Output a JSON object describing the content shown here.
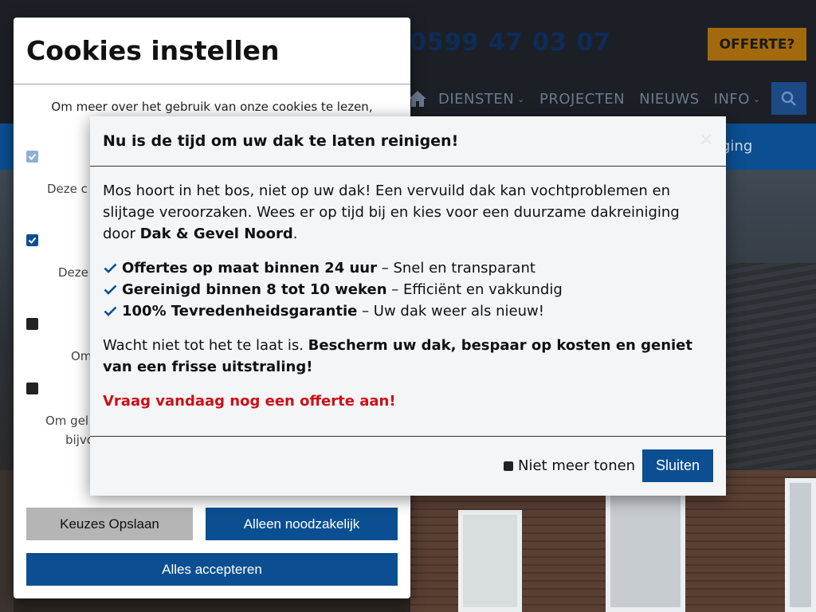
{
  "site": {
    "phone": "0599 47 03 07",
    "offer_button": "OFFERTE?",
    "nav": [
      {
        "label": "DIENSTEN",
        "has_dropdown": true
      },
      {
        "label": "PROJECTEN",
        "has_dropdown": false
      },
      {
        "label": "NIEUWS",
        "has_dropdown": false
      },
      {
        "label": "INFO",
        "has_dropdown": true
      }
    ],
    "bar_fragment": "ging"
  },
  "cookies": {
    "title": "Cookies instellen",
    "intro": "Om meer over het gebruik van onze cookies te lezen, bekijk",
    "categories": [
      {
        "state": "disabled",
        "desc_fragment": "Deze c"
      },
      {
        "state": "checked",
        "desc_fragment": "Deze"
      },
      {
        "state": "unchecked",
        "desc_fragment": "Om"
      },
      {
        "state": "unchecked",
        "desc_fragment_line1": "Om gel",
        "desc_fragment_line2": "bijvo"
      }
    ],
    "buttons": {
      "save": "Keuzes Opslaan",
      "necessary": "Alleen noodzakelijk",
      "accept_all": "Alles accepteren"
    }
  },
  "modal": {
    "title": "Nu is de tijd om uw dak te laten reinigen!",
    "intro": "Mos hoort in het bos, niet op uw dak! Een vervuild dak kan vochtproblemen en slijtage veroorzaken. Wees er op tijd bij en kies voor een duurzame dakreiniging door ",
    "company": "Dak & Gevel Noord",
    "intro_end": ".",
    "benefits": [
      {
        "bold": "Offertes op maat binnen 24 uur",
        "rest": " – Snel en transparant"
      },
      {
        "bold": "Gereinigd binnen 8 tot 10 weken",
        "rest": " – Efficiënt en vakkundig"
      },
      {
        "bold": "100% Tevredenheidsgarantie",
        "rest": " – Uw dak weer als nieuw!"
      }
    ],
    "closing_plain": "Wacht niet tot het te laat is. ",
    "closing_bold": "Bescherm uw dak, bespaar op kosten en geniet van een frisse uitstraling!",
    "cta": "Vraag vandaag nog een offerte aan!",
    "dont_show": "Niet meer tonen",
    "close_button": "Sluiten"
  },
  "colors": {
    "primary": "#0b4f92",
    "cta_red": "#cc1016",
    "offer_gold": "#a3690d"
  }
}
